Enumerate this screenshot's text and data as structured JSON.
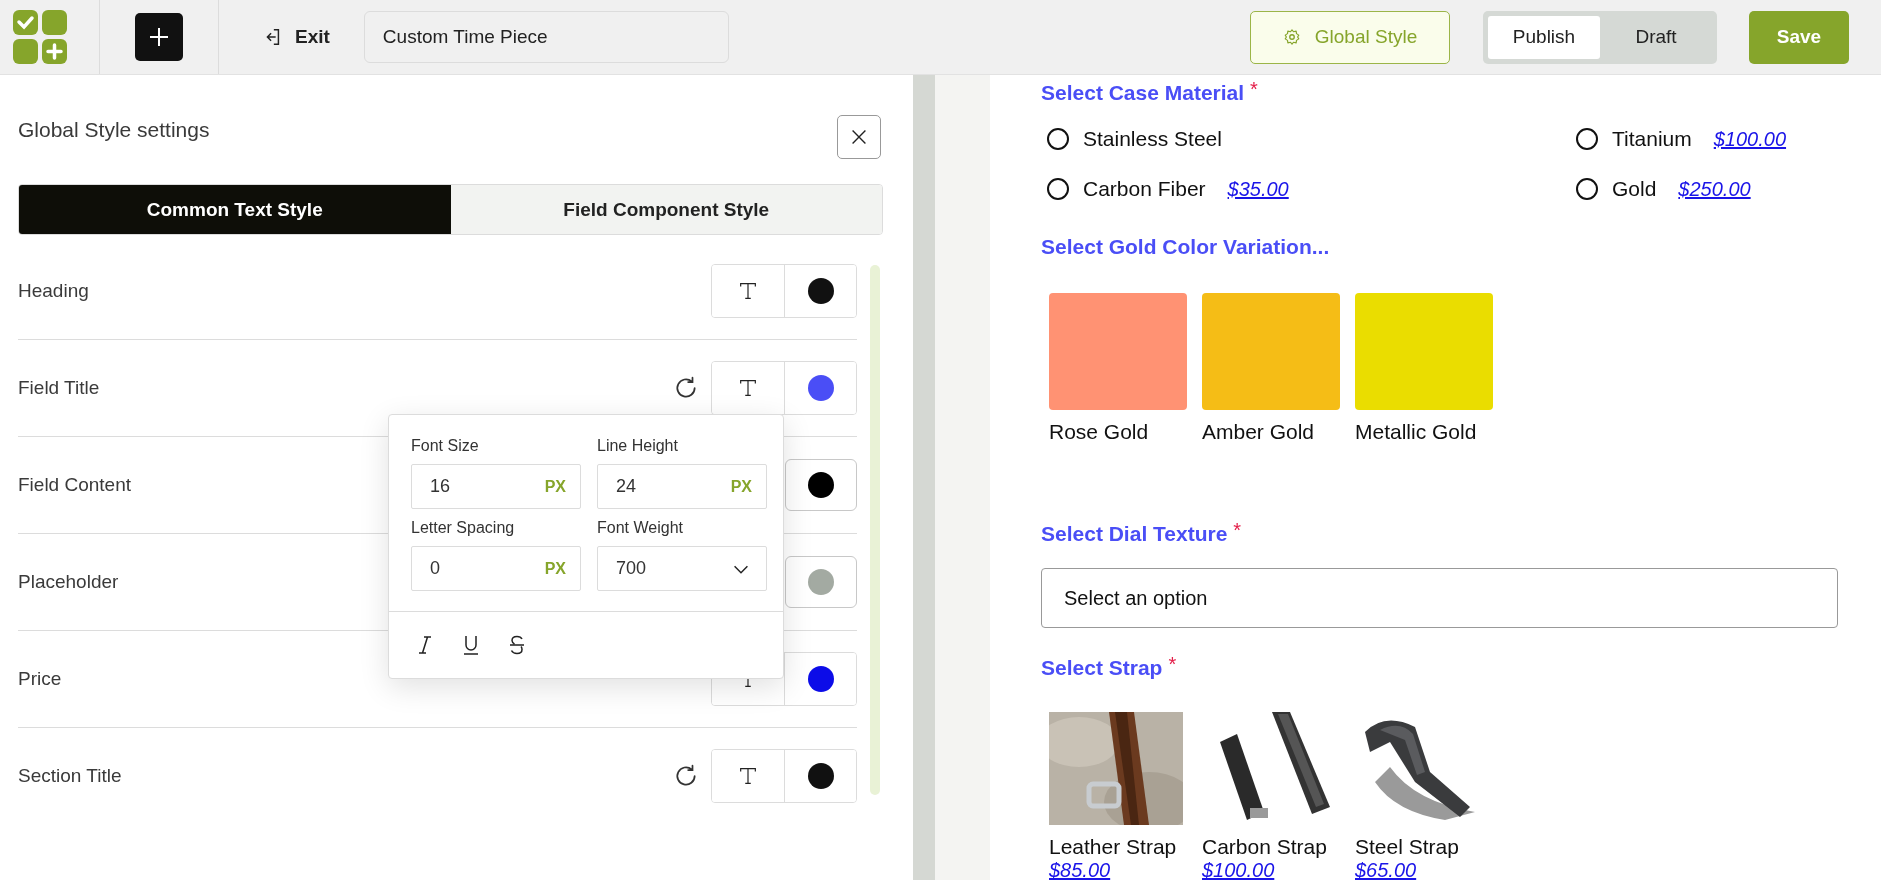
{
  "topbar": {
    "exit": "Exit",
    "title_value": "Custom Time Piece",
    "global_style": "Global Style",
    "modes": [
      {
        "label": "Publish",
        "selected": true
      },
      {
        "label": "Draft",
        "selected": false
      }
    ],
    "save": "Save"
  },
  "panel": {
    "title": "Global Style settings",
    "tabs": [
      {
        "label": "Common Text Style",
        "selected": true
      },
      {
        "label": "Field Component Style",
        "selected": false
      }
    ],
    "rows": [
      {
        "label": "Heading",
        "reset": false,
        "color": "#111111"
      },
      {
        "label": "Field Title",
        "reset": true,
        "color": "#4a4ef6"
      },
      {
        "label": "Field Content",
        "kind": "color_only",
        "color": "#000000"
      },
      {
        "label": "Placeholder",
        "kind": "color_only",
        "color": "#a3aaa2"
      },
      {
        "label": "Price",
        "color": "#0c0ce8"
      },
      {
        "label": "Section Title",
        "reset": true,
        "color": "#111111"
      }
    ]
  },
  "popover": {
    "fields": [
      {
        "label": "Font Size",
        "value": "16",
        "unit": "PX",
        "kind": "number"
      },
      {
        "label": "Line Height",
        "value": "24",
        "unit": "PX",
        "kind": "number"
      },
      {
        "label": "Letter Spacing",
        "value": "0",
        "unit": "PX",
        "kind": "number"
      },
      {
        "label": "Font Weight",
        "value": "700",
        "kind": "select"
      }
    ]
  },
  "form": {
    "sections": [
      {
        "kind": "radio",
        "title": "Select Case Material",
        "required_mark": "*",
        "options": [
          {
            "label": "Stainless Steel",
            "selected": false
          },
          {
            "label": "Titanium",
            "price": "$100.00",
            "selected": false
          },
          {
            "label": "Carbon Fiber",
            "price": "$35.00",
            "selected": false
          },
          {
            "label": "Gold",
            "price": "$250.00",
            "selected": false
          }
        ]
      },
      {
        "kind": "swatch",
        "title": "Select Gold Color Variation...",
        "options": [
          {
            "label": "Rose Gold",
            "color": "#ff9273"
          },
          {
            "label": "Amber Gold",
            "color": "#f5bd16"
          },
          {
            "label": "Metallic Gold",
            "color": "#eadd00"
          }
        ]
      },
      {
        "kind": "select",
        "title": "Select Dial Texture",
        "required_mark": "*",
        "value": "Select an option"
      },
      {
        "title": "Select Strap",
        "required_mark": "*",
        "options": [
          {
            "label": "Leather Strap",
            "price": "$85.00"
          },
          {
            "label": "Carbon Strap",
            "price": "$100.00"
          },
          {
            "label": "Steel Strap",
            "price": "$65.00"
          }
        ]
      }
    ]
  }
}
